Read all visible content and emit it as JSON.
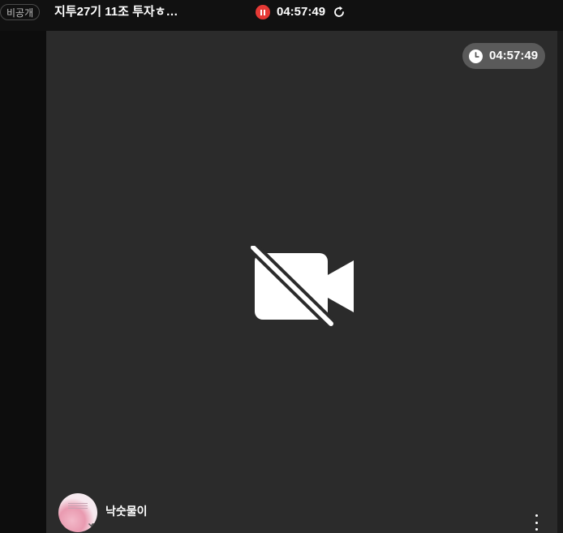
{
  "topbar": {
    "privacy_label": "비공개",
    "title": "지투27기 11조 투자ㅎ…",
    "recording_time": "04:57:49"
  },
  "video_tile": {
    "timer": "04:57:49",
    "camera_state_icon": "video-off-icon",
    "participant": {
      "name": "낙숫물이",
      "mic_state_icon": "mic-off-icon"
    }
  },
  "colors": {
    "background": "#111111",
    "tile": "#2b2b2b",
    "recording": "#e53935",
    "timer_pill": "#5a5a5a"
  }
}
